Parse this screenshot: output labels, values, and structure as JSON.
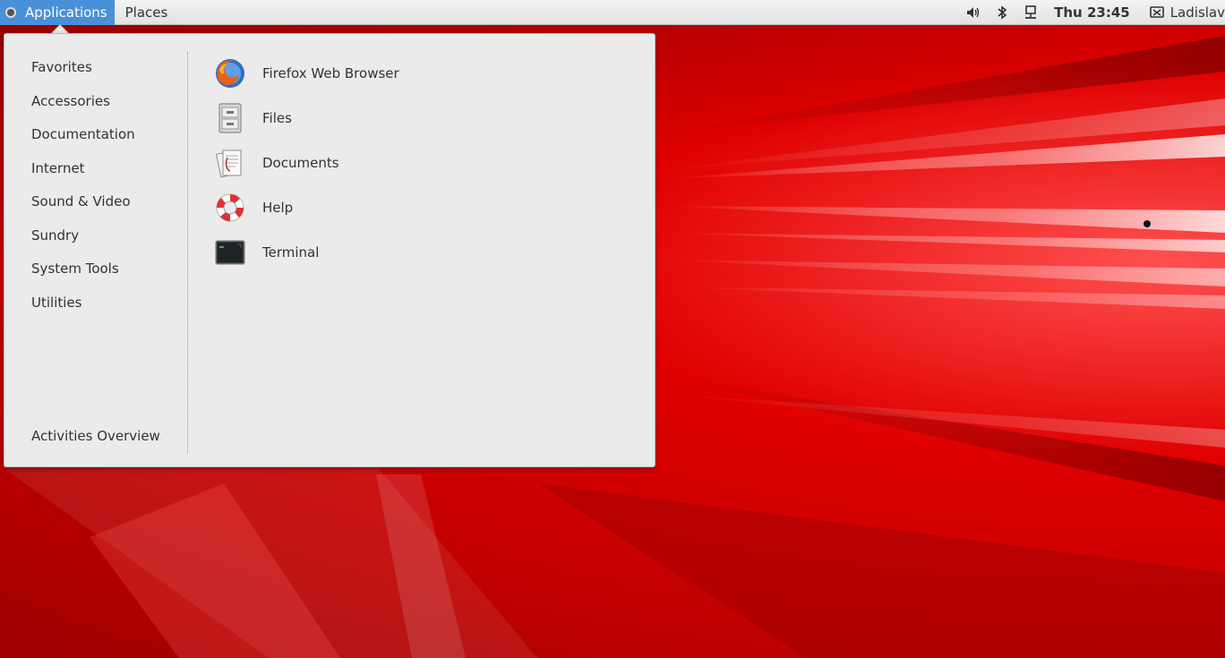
{
  "top_bar": {
    "applications_label": "Applications",
    "places_label": "Places",
    "clock": "Thu 23:45",
    "user_name": "Ladislav",
    "tray_icons": [
      "volume-icon",
      "bluetooth-icon",
      "network-wired-icon",
      "user-icon"
    ]
  },
  "menu": {
    "categories": [
      {
        "label": "Favorites"
      },
      {
        "label": "Accessories"
      },
      {
        "label": "Documentation"
      },
      {
        "label": "Internet"
      },
      {
        "label": "Sound & Video"
      },
      {
        "label": "Sundry"
      },
      {
        "label": "System Tools"
      },
      {
        "label": "Utilities"
      }
    ],
    "activities_label": "Activities Overview",
    "apps": [
      {
        "label": "Firefox Web Browser",
        "icon": "firefox-icon"
      },
      {
        "label": "Files",
        "icon": "files-icon"
      },
      {
        "label": "Documents",
        "icon": "documents-icon"
      },
      {
        "label": "Help",
        "icon": "help-icon"
      },
      {
        "label": "Terminal",
        "icon": "terminal-icon"
      }
    ]
  },
  "colors": {
    "accent": "#4a90d9",
    "wallpaper": "#d80000",
    "menu_background": "#ebebeb"
  }
}
